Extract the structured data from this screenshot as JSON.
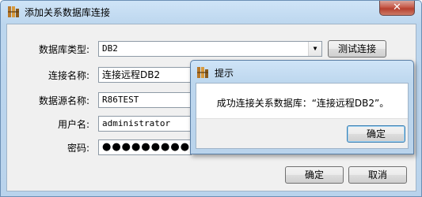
{
  "main_window": {
    "title": "添加关系数据库连接",
    "close_symbol": "✕",
    "form": {
      "db_type_label": "数据库类型:",
      "db_type_value": "DB2",
      "test_button": "测试连接",
      "conn_name_label": "连接名称:",
      "conn_name_value": "连接远程DB2",
      "datasource_label": "数据源名称:",
      "datasource_value": "R86TEST",
      "username_label": "用户名:",
      "username_value": "administrator",
      "password_label": "密码:",
      "password_value": "●●●●●●●●●"
    },
    "ok_button": "确定",
    "cancel_button": "取消"
  },
  "dialog": {
    "title": "提示",
    "message": "成功连接关系数据库：“连接远程DB2”。",
    "ok_button": "确定"
  },
  "icons": {
    "app": "app-icon",
    "dropdown": "chevron-down-icon"
  }
}
